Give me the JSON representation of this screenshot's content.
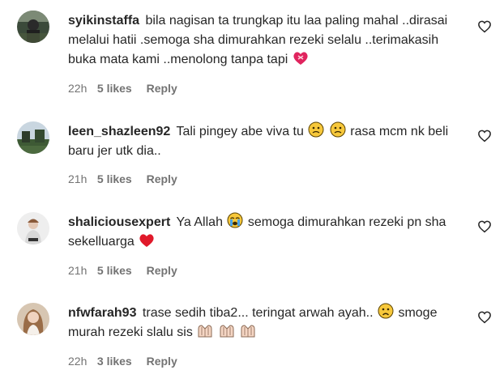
{
  "comments": [
    {
      "username": "syikinstaffa",
      "text": "bila nagisan ta trungkap itu laa paling mahal ..dirasai melalui hatii .semoga sha dimurahkan rezeki selalu ..terimakasih buka mata kami ..menolong tanpa tapi",
      "emojis": [
        "heart-with-ribbon"
      ],
      "time": "22h",
      "likes": "5 likes",
      "reply": "Reply"
    },
    {
      "username": "leen_shazleen92",
      "text_before": "Tali pingey abe viva tu",
      "text_after": "rasa mcm nk beli baru jer utk dia..",
      "emojis": [
        "confused-face",
        "confused-face"
      ],
      "time": "21h",
      "likes": "5 likes",
      "reply": "Reply"
    },
    {
      "username": "shaliciousexpert",
      "text_before": "Ya Allah",
      "text_after": "semoga dimurahkan rezeki pn sha sekelluarga",
      "emojis": [
        "crying-face",
        "red-heart"
      ],
      "time": "21h",
      "likes": "5 likes",
      "reply": "Reply"
    },
    {
      "username": "nfwfarah93",
      "text_before": "trase sedih tiba2... teringat arwah ayah..",
      "text_after": "smoge murah rezeki slalu sis",
      "emojis": [
        "sad-face",
        "folded-hands",
        "folded-hands",
        "folded-hands"
      ],
      "time": "22h",
      "likes": "3 likes",
      "reply": "Reply"
    }
  ],
  "colors": {
    "text": "#262626",
    "secondary": "#737373",
    "heart_emoji": "#e0245e"
  }
}
